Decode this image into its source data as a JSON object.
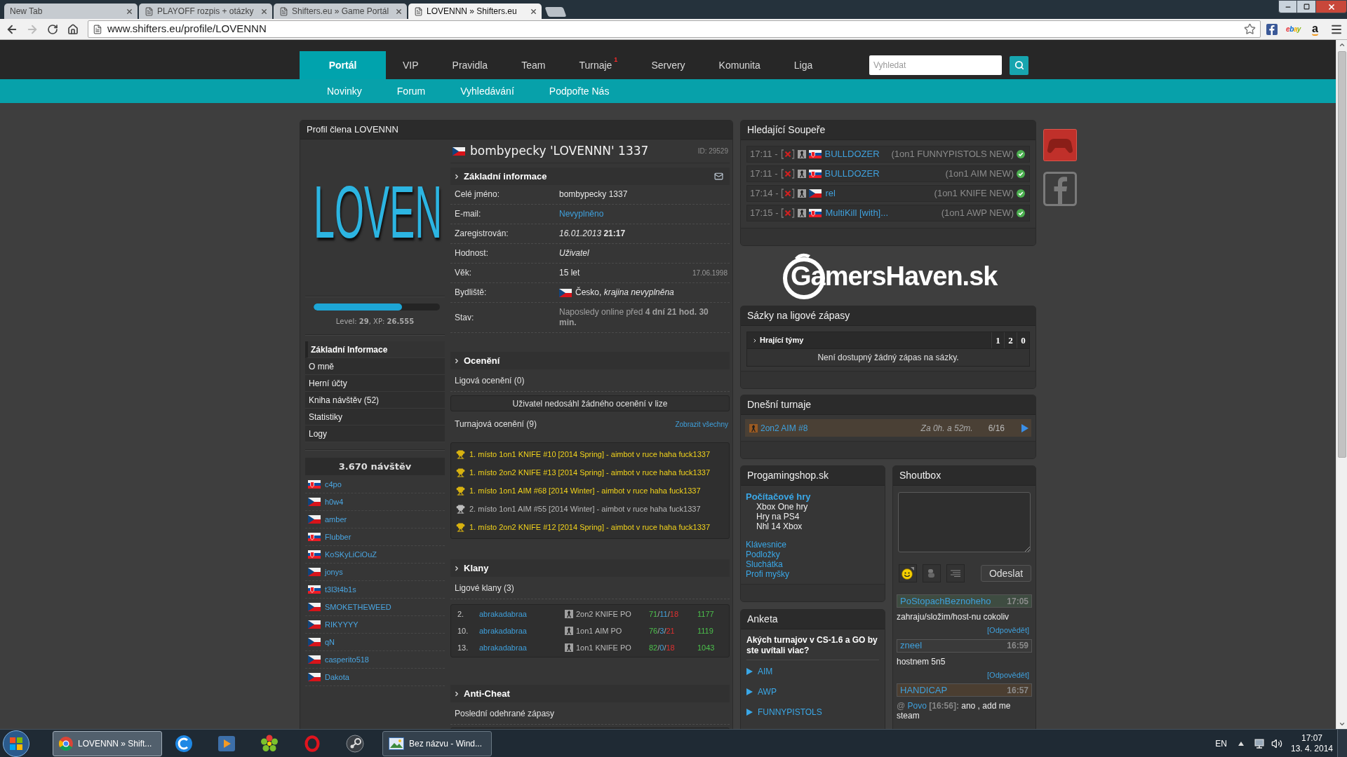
{
  "browser": {
    "tabs": [
      {
        "title": "New Tab",
        "favicon": false,
        "selected": false
      },
      {
        "title": "PLAYOFF rozpis + otázky",
        "favicon": true,
        "selected": false
      },
      {
        "title": "Shifters.eu » Game Portál",
        "favicon": true,
        "selected": false
      },
      {
        "title": "LOVENNN » Shifters.eu",
        "favicon": true,
        "selected": true
      }
    ],
    "forward_enabled": false,
    "url": "www.shifters.eu/profile/LOVENNN",
    "extensions": [
      {
        "kind": "facebook"
      },
      {
        "kind": "multicolor",
        "label": "ebay"
      },
      {
        "kind": "letter",
        "label": "a"
      }
    ]
  },
  "site_nav": {
    "items": [
      {
        "label": "Portál",
        "selected": true
      },
      {
        "label": "VIP",
        "selected": false
      },
      {
        "label": "Pravidla",
        "selected": false
      },
      {
        "label": "Team",
        "selected": false
      },
      {
        "label": "Turnaje",
        "selected": false,
        "badge": "1"
      },
      {
        "label": "Servery",
        "selected": false
      },
      {
        "label": "Komunita",
        "selected": false
      },
      {
        "label": "Liga",
        "selected": false
      }
    ],
    "search": {
      "placeholder": "Vyhledat"
    },
    "subnav": [
      "Novinky",
      "Forum",
      "Vyhledávání",
      "Podpořte Nás"
    ]
  },
  "profile": {
    "title": "Profil člena LOVENNN",
    "avatar_text": "LOVEN",
    "xp": {
      "level": 0.7,
      "caption": "Level: **29**, XP: **26.555**"
    },
    "menu": [
      {
        "label": "Základní Informace",
        "selected": true
      },
      {
        "label": "O mně",
        "selected": false
      },
      {
        "label": "Herní účty",
        "selected": false
      },
      {
        "label": "Kniha návštěv (52)",
        "selected": false
      },
      {
        "label": "Statistiky",
        "selected": false
      },
      {
        "label": "Logy",
        "selected": false
      }
    ],
    "visits": "3.670 návštěv",
    "visitors": [
      {
        "name": "c4po",
        "flag": {
          "kind": "sk"
        }
      },
      {
        "name": "h0w4",
        "flag": {
          "kind": "cz"
        }
      },
      {
        "name": "amber",
        "flag": {
          "kind": "cz"
        }
      },
      {
        "name": "Flubber",
        "flag": {
          "kind": "sk"
        }
      },
      {
        "name": "KoSKyLiCiOuZ",
        "flag": {
          "kind": "sk"
        }
      },
      {
        "name": "jonys",
        "flag": {
          "kind": "cz"
        }
      },
      {
        "name": "t3l3t4b1s",
        "flag": {
          "kind": "sk"
        }
      },
      {
        "name": "SMOKETHEWEED",
        "flag": {
          "kind": "cz"
        }
      },
      {
        "name": "RIKYYYY",
        "flag": {
          "kind": "cz"
        }
      },
      {
        "name": "qN",
        "flag": {
          "kind": "cz"
        }
      },
      {
        "name": "casperito518",
        "flag": {
          "kind": "cz"
        }
      },
      {
        "name": "Dakota",
        "flag": {
          "kind": "cz"
        }
      }
    ],
    "name": "bombypecky 'LOVENNN' 1337",
    "flag": {
      "kind": "cz"
    },
    "id": "ID: 29529",
    "basic": {
      "heading": "Základní informace",
      "rows": [
        {
          "label": "Celé jméno:",
          "kind": "text",
          "value": "bombypecky 1337"
        },
        {
          "label": "E-mail:",
          "kind": "link",
          "value": "Nevyplněno"
        },
        {
          "label": "Zaregistrován:",
          "kind": "text",
          "value": "*16.01.2013* **21:17**"
        },
        {
          "label": "Hodnost:",
          "kind": "italic",
          "value": "Uživatel"
        },
        {
          "label": "Věk:",
          "kind": "text",
          "value": "15 let",
          "note": "17.06.1998"
        },
        {
          "label": "Bydliště:",
          "kind": "text",
          "flag": {
            "kind": "cz"
          },
          "value": "Česko, *krajina nevyplněna*"
        },
        {
          "label": "Stav:",
          "kind": "muted",
          "value": "Naposledy online před **4 dní 21 hod. 30 min.**"
        }
      ]
    },
    "awards": {
      "heading": "Ocenění",
      "league_label": "Ligová ocenění (0)",
      "league_empty": "Uživatel nedosáhl žádného ocenění v lize",
      "tournament_label": "Turnajová ocenění (9)",
      "show_all": "Zobrazit všechny",
      "items": [
        {
          "kind": "gold",
          "text": "1. místo 1on1 KNIFE #10 [2014 Spring] - aimbot v ruce haha fuck1337"
        },
        {
          "kind": "gold",
          "text": "1. místo 2on2 KNIFE #13 [2014 Spring] - aimbot v ruce haha fuck1337"
        },
        {
          "kind": "gold",
          "text": "1. místo 1on1 AIM #68 [2014 Winter] - aimbot v ruce haha fuck1337"
        },
        {
          "kind": "silver",
          "text": "2. místo 1on1 AIM #55 [2014 Winter] - aimbot v ruce haha fuck1337"
        },
        {
          "kind": "gold",
          "text": "1. místo 2on2 KNIFE #12 [2014 Spring] - aimbot v ruce haha fuck1337"
        }
      ]
    },
    "clans": {
      "heading": "Klany",
      "label": "Ligové klany (3)",
      "rows": [
        {
          "rank": "2.",
          "name": "abrakadabraa",
          "league": "2on2 KNIFE PO",
          "score": "71/11/18",
          "points": "1177"
        },
        {
          "rank": "10.",
          "name": "abrakadabraa",
          "league": "1on1 AIM PO",
          "score": "76/3/21",
          "points": "1119"
        },
        {
          "rank": "13.",
          "name": "abrakadabraa",
          "league": "1on1 KNIFE PO",
          "score": "82/0/18",
          "points": "1043"
        }
      ]
    },
    "anticheat": {
      "heading": "Anti-Cheat",
      "label": "Poslední odehrané zápasy"
    }
  },
  "opponents": {
    "title": "Hledající Soupeře",
    "rows": [
      {
        "time": "17:11 -",
        "flag": {
          "kind": "sk"
        },
        "name": "BULLDOZER",
        "mode": "(1on1 FUNNYPISTOLS NEW)"
      },
      {
        "time": "17:11 -",
        "flag": {
          "kind": "sk"
        },
        "name": "BULLDOZER",
        "mode": "(1on1 AIM NEW)"
      },
      {
        "time": "17:14 -",
        "flag": {
          "kind": "cz"
        },
        "name": "rel",
        "mode": "(1on1 KNIFE NEW)"
      },
      {
        "time": "17:15 -",
        "flag": {
          "kind": "sk"
        },
        "name": "MultiKill [with]...",
        "mode": "(1on1 AWP NEW)"
      }
    ]
  },
  "sponsor": {
    "logo": "GamersHaven.sk"
  },
  "bets": {
    "title": "Sázky na ligové zápasy",
    "columns": [
      "Hrající týmy",
      "1",
      "2",
      "0"
    ],
    "empty": "Není dostupný žádný zápas na sázky."
  },
  "tournaments": {
    "title": "Dnešní turnaje",
    "rows": [
      {
        "name": "2on2 AIM #8",
        "eta": "Za 0h. a 52m.",
        "slots": "6/16"
      }
    ]
  },
  "shop": {
    "title": "Progamingshop.sk",
    "category": "Počítačové hry",
    "subitems": [
      "Xbox One hry",
      "Hry na PS4",
      "Nhl 14 Xbox"
    ],
    "links": [
      "Klávesnice",
      "Podložky",
      "Sluchátka",
      "Profi myšky"
    ]
  },
  "poll": {
    "title": "Anketa",
    "question": "Akých turnajov v CS-1.6 a GO by ste uvítali viac?",
    "options": [
      "AIM",
      "AWP",
      "FUNNYPISTOLS"
    ]
  },
  "shoutbox": {
    "title": "Shoutbox",
    "send": "Odeslat",
    "messages": [
      {
        "author": "PoStopachBeznoheho",
        "time": "17:05",
        "color": "#3e4c41",
        "text": "zahraju/složim/host-nu cokoliv",
        "reply": "[Odpovědět]"
      },
      {
        "author": "zneel",
        "time": "16:59",
        "color": "#3a3a3a",
        "text": "hostnem 5n5",
        "reply": "[Odpovědět]"
      },
      {
        "author": "HANDICAP",
        "time": "16:57",
        "color": "#4b3e31",
        "mention": {
          "prefix": "@",
          "user": "Povo",
          "time": "[16:56]:"
        },
        "text": "ano , add me steam"
      }
    ]
  },
  "taskbar": {
    "windows": [
      {
        "title": "LOVENNN » Shift...",
        "selected": true
      },
      {
        "title": "Bez názvu - Wind...",
        "selected": false
      }
    ],
    "language": "EN",
    "time": "17:07",
    "date": "13. 4. 2014"
  }
}
